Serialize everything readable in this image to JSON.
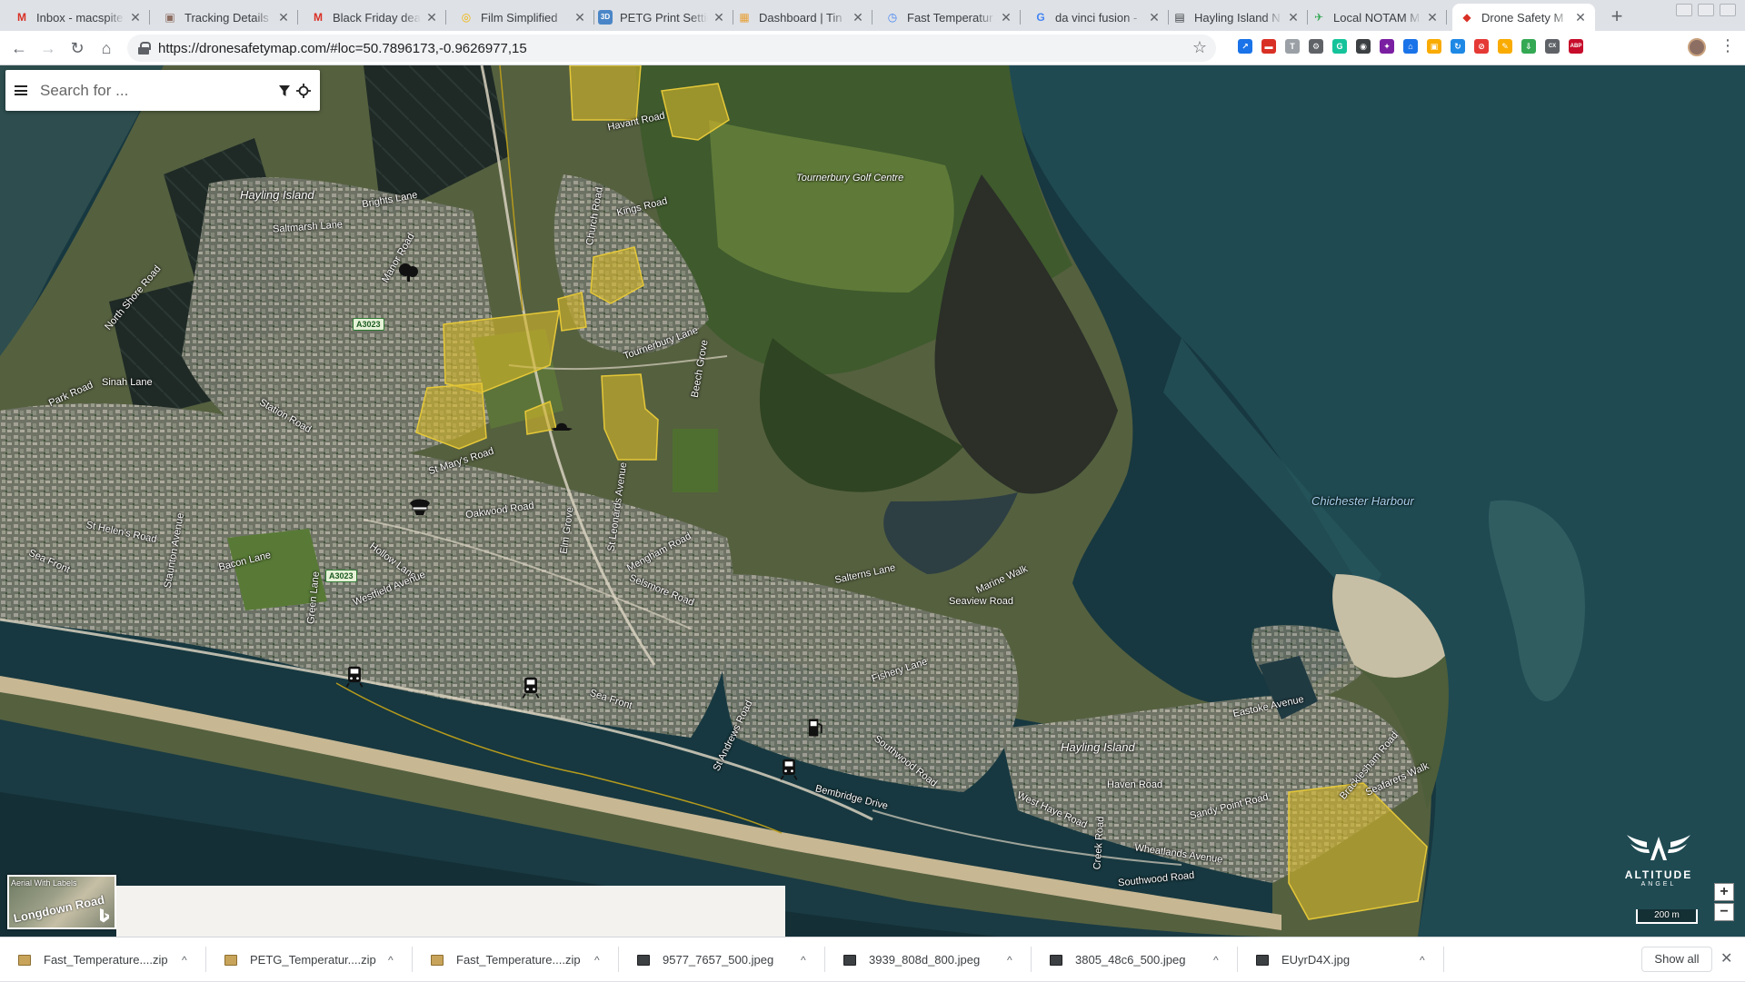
{
  "browser": {
    "tabs": [
      {
        "title": "Inbox - macspite",
        "icon": "gmail-icon",
        "icon_char": "M",
        "color": "#d93025"
      },
      {
        "title": "Tracking Details",
        "icon": "package-icon",
        "icon_char": "▣",
        "color": "#8d6e63"
      },
      {
        "title": "Black Friday deal",
        "icon": "gmail-icon",
        "icon_char": "M",
        "color": "#d93025"
      },
      {
        "title": "Film Simplified",
        "icon": "google-drive-icon",
        "icon_char": "◎",
        "color": "#f4b400"
      },
      {
        "title": "PETG Print Settin",
        "icon": "3d-icon",
        "icon_char": "3D",
        "color": "#4a86c7"
      },
      {
        "title": "Dashboard | Tin",
        "icon": "dashboard-icon",
        "icon_char": "▦",
        "color": "#e8a23a"
      },
      {
        "title": "Fast Temperatur",
        "icon": "document-icon",
        "icon_char": "◷",
        "color": "#4285f4"
      },
      {
        "title": "da vinci fusion -",
        "icon": "google-icon",
        "icon_char": "G",
        "color": "#4285f4"
      },
      {
        "title": "Hayling Island N",
        "icon": "news-icon",
        "icon_char": "▤",
        "color": "#3c4043"
      },
      {
        "title": "Local NOTAM M",
        "icon": "notam-icon",
        "icon_char": "✈",
        "color": "#34a853"
      },
      {
        "title": "Drone Safety M",
        "icon": "drone-safety-icon",
        "icon_char": "◆",
        "color": "#d93025"
      }
    ],
    "url": "https://dronesafetymap.com/#loc=50.7896173,-0.9626977,15",
    "extensions": [
      {
        "name": "extension-arrow-icon",
        "char": "↗",
        "color": "#1a73e8"
      },
      {
        "name": "extension-red-icon",
        "char": "▬",
        "color": "#d93025"
      },
      {
        "name": "extension-text-icon",
        "char": "T",
        "color": "#9aa0a6"
      },
      {
        "name": "extension-gear-icon",
        "char": "⚙",
        "color": "#5f6368"
      },
      {
        "name": "grammarly-icon",
        "char": "G",
        "color": "#15c39a"
      },
      {
        "name": "extension-camera-icon",
        "char": "◉",
        "color": "#3c4043"
      },
      {
        "name": "extension-pinwheel-icon",
        "char": "✦",
        "color": "#7b1fa2"
      },
      {
        "name": "extension-home-icon",
        "char": "⌂",
        "color": "#1a73e8"
      },
      {
        "name": "extension-box-icon",
        "char": "▣",
        "color": "#f9ab00"
      },
      {
        "name": "extension-sync-icon",
        "char": "↻",
        "color": "#1e88e5"
      },
      {
        "name": "extension-block-icon",
        "char": "⊘",
        "color": "#e53935"
      },
      {
        "name": "extension-pen-icon",
        "char": "✎",
        "color": "#f9ab00"
      },
      {
        "name": "extension-download-icon",
        "char": "⇩",
        "color": "#34a853"
      },
      {
        "name": "extension-cx-icon",
        "char": "CX",
        "color": "#5f6368"
      },
      {
        "name": "adblock-plus-icon",
        "char": "ABP",
        "color": "#c70d2c"
      }
    ]
  },
  "map": {
    "search_placeholder": "Search for ...",
    "labels": {
      "hayling_island_nw": "Hayling Island",
      "hayling_island_se": "Hayling Island",
      "golf_centre": "Tournerbury Golf Centre",
      "chichester_harbour": "Chichester Harbour",
      "havant_road": "Havant Road",
      "brights_lane": "Brights Lane",
      "saltmarsh_lane": "Saltmarsh Lane",
      "manor_road": "Manor Road",
      "north_shore_road": "North Shore Road",
      "church_road": "Church Road",
      "kings_road": "Kings Road",
      "tournerbury_lane": "Tournerbury Lane",
      "beech_grove": "Beech Grove",
      "sinah_lane": "Sinah Lane",
      "park_road": "Park Road",
      "station_road": "Station Road",
      "st_marys_road": "St Mary's Road",
      "oakwood_road": "Oakwood Road",
      "elm_grove": "Elm Grove",
      "st_leonards_avenue": "St Leonards Avenue",
      "mengham_road": "Mengham Road",
      "selsmore_road": "Selsmore Road",
      "bacon_lane": "Bacon Lane",
      "hollow_lane": "Hollow Lane",
      "westfield_avenue": "Westfield Avenue",
      "sea_front_w": "Sea Front",
      "sea_front_e": "Sea Front",
      "st_helens_road": "St Helen's Road",
      "staunton_avenue": "Staunton Avenue",
      "green_lane": "Green Lane",
      "salterns_lane": "Salterns Lane",
      "seaview_road": "Seaview Road",
      "marine_walk": "Marine Walk",
      "fishery_lane": "Fishery Lane",
      "southwood_road": "Southwood Road",
      "bembridge_drive": "Bembridge Drive",
      "west_haye_road": "West Haye Road",
      "haven_road": "Haven Road",
      "sandy_point_road": "Sandy Point Road",
      "eastoke_avenue": "Eastoke Avenue",
      "wheatlands_avenue": "Wheatlands Avenue",
      "southwood_road_e": "Southwood Road",
      "bracklesham_road": "Bracklesham Road",
      "seafarers_walk": "Seafarers Walk",
      "creek_road": "Creek Road",
      "st_andrews_road": "St Andrews Road",
      "a3023_north": "A3023",
      "a3023_south": "A3023"
    },
    "layer_toggle_label": "Aerial With Labels",
    "layer_toggle_street": "Longdown Road",
    "logo_wordmark": "ALTITUDE",
    "logo_sub": "ANGEL",
    "zoom_in": "+",
    "zoom_out": "−",
    "scale": "200 m"
  },
  "downloads": {
    "items": [
      {
        "name": "Fast_Temperature....zip",
        "type": "zip"
      },
      {
        "name": "PETG_Temperatur....zip",
        "type": "zip"
      },
      {
        "name": "Fast_Temperature....zip",
        "type": "zip"
      },
      {
        "name": "9577_7657_500.jpeg",
        "type": "img"
      },
      {
        "name": "3939_808d_800.jpeg",
        "type": "img"
      },
      {
        "name": "3805_48c6_500.jpeg",
        "type": "img"
      },
      {
        "name": "EUyrD4X.jpg",
        "type": "img"
      }
    ],
    "show_all": "Show all"
  }
}
